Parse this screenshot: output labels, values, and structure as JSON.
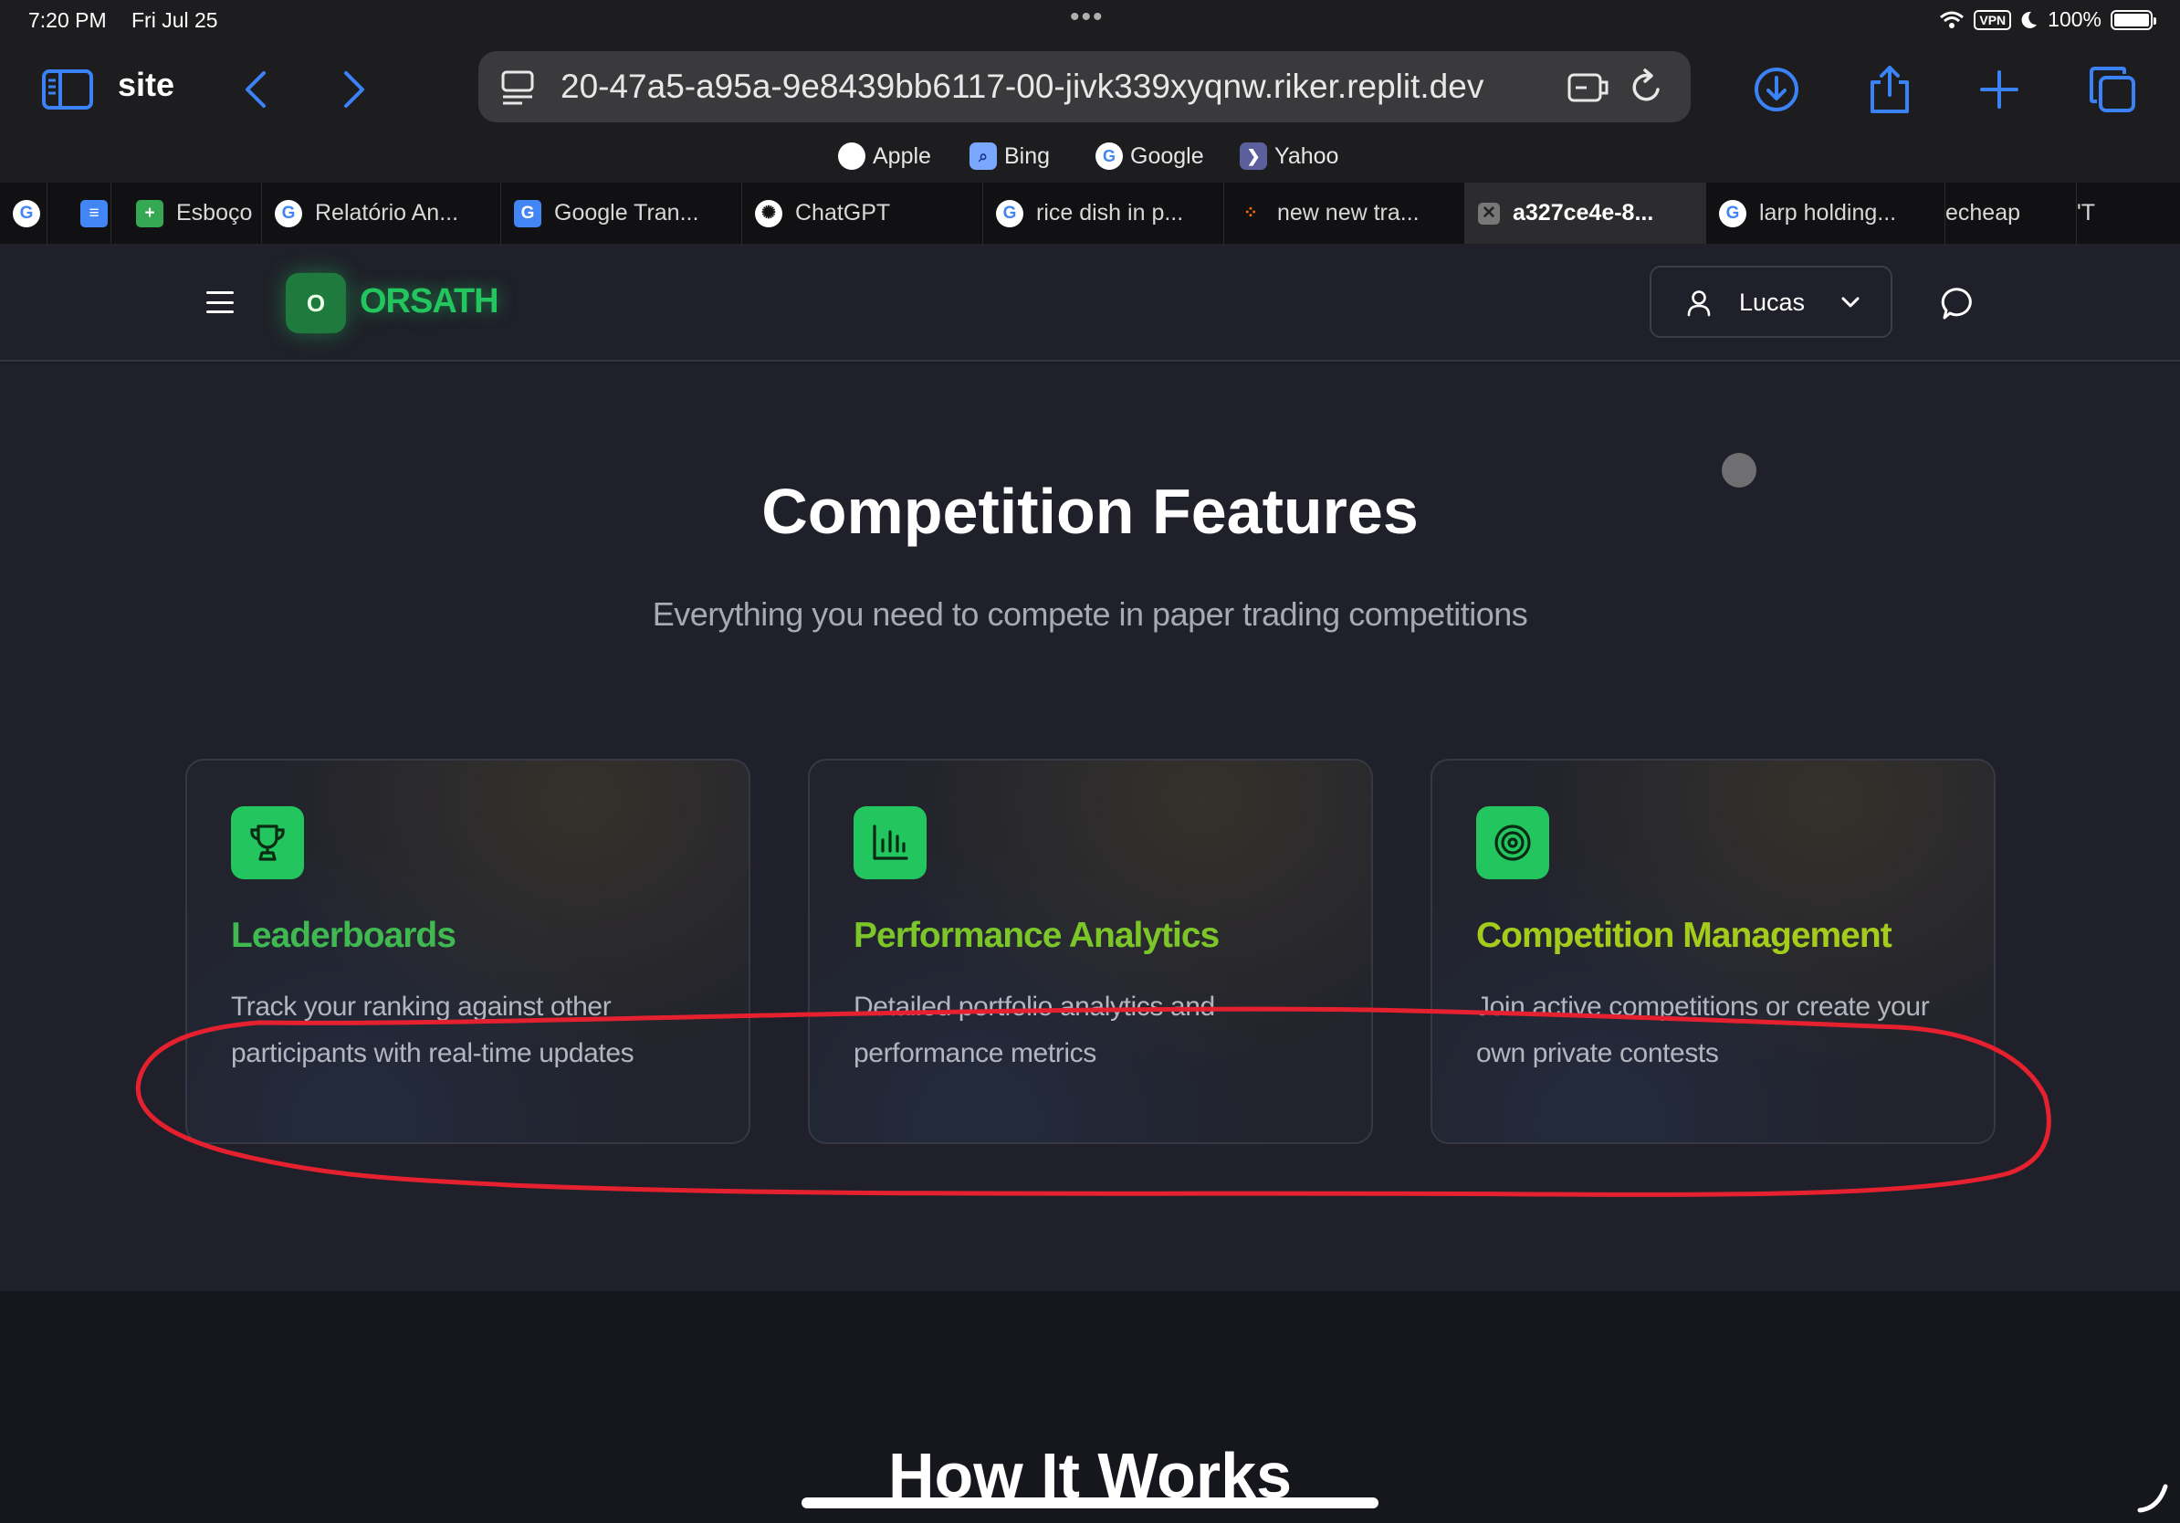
{
  "status_bar": {
    "time": "7:20 PM",
    "date": "Fri Jul 25",
    "vpn": "VPN",
    "battery": "100%"
  },
  "browser": {
    "sidebar_label": "site",
    "url": "20-47a5-a95a-9e8439bb6117-00-jivk339xyqnw.riker.replit.dev",
    "favorites": [
      "Apple",
      "Bing",
      "Google",
      "Yahoo"
    ],
    "tabs": [
      {
        "label": ""
      },
      {
        "label": ""
      },
      {
        "label": "Esboço"
      },
      {
        "label": "Relatório An..."
      },
      {
        "label": "Google Tran..."
      },
      {
        "label": "ChatGPT"
      },
      {
        "label": "rice dish in p..."
      },
      {
        "label": "new new tra..."
      },
      {
        "label": "a327ce4e-8...",
        "active": true
      },
      {
        "label": "larp holding..."
      },
      {
        "label": "echeap"
      },
      {
        "label": "'T"
      }
    ]
  },
  "site": {
    "logo_letter": "O",
    "brand": "ORSATH",
    "user": "Lucas",
    "accent": "#22c55e",
    "features": {
      "title": "Competition Features",
      "subtitle": "Everything you need to compete in paper trading competitions",
      "cards": [
        {
          "icon": "trophy-icon",
          "title": "Leaderboards",
          "description": "Track your ranking against other participants with real-time updates"
        },
        {
          "icon": "bar-chart-icon",
          "title": "Performance Analytics",
          "description": "Detailed portfolio analytics and performance metrics"
        },
        {
          "icon": "target-icon",
          "title": "Competition Management",
          "description": "Join active competitions or create your own private contests"
        }
      ]
    },
    "how_it_works": {
      "title": "How It Works"
    }
  },
  "annotation": {
    "color": "#e5202f"
  }
}
